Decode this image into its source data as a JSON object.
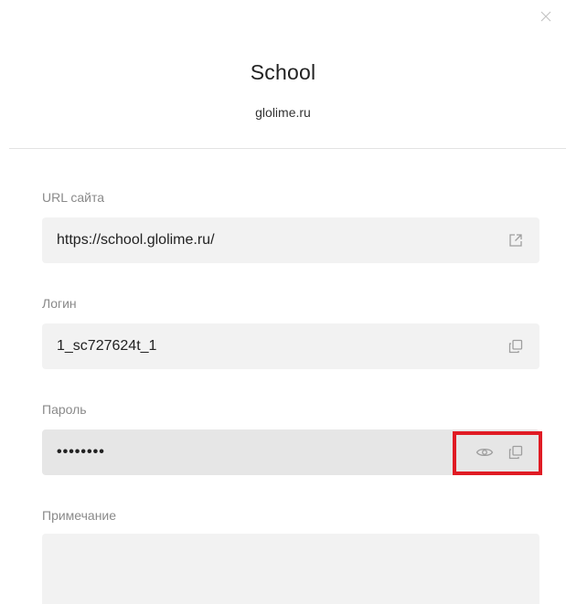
{
  "header": {
    "title": "School",
    "subtitle": "glolime.ru"
  },
  "fields": {
    "url": {
      "label": "URL сайта",
      "value": "https://school.glolime.ru/"
    },
    "login": {
      "label": "Логин",
      "value": "1_sc727624t_1"
    },
    "password": {
      "label": "Пароль",
      "value": "••••••••"
    },
    "note": {
      "label": "Примечание",
      "value": ""
    }
  },
  "icons": {
    "close": "close-icon",
    "open_link": "external-link-icon",
    "copy": "copy-icon",
    "show_password": "eye-icon"
  },
  "colors": {
    "highlight": "#e01b24",
    "field_bg": "#f2f2f2",
    "field_focused_bg": "#e6e6e6",
    "label": "#8a8a8a"
  }
}
